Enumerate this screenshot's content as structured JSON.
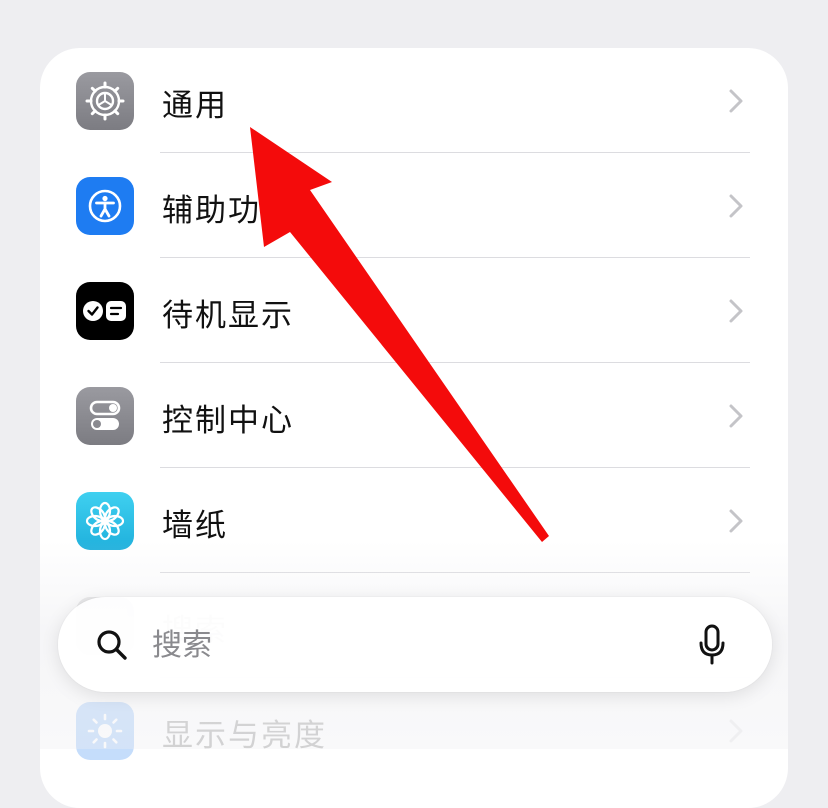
{
  "settings": {
    "items": [
      {
        "label": "通用",
        "icon": "gear-icon",
        "color": "#8e8e93"
      },
      {
        "label": "辅助功能",
        "icon": "accessibility-icon",
        "color": "#1e7cf2"
      },
      {
        "label": "待机显示",
        "icon": "standby-icon",
        "color": "#000000"
      },
      {
        "label": "控制中心",
        "icon": "toggles-icon",
        "color": "#8e8e93"
      },
      {
        "label": "墙纸",
        "icon": "flower-icon",
        "color": "#2ec4e8"
      },
      {
        "label": "显示与亮度",
        "icon": "sun-icon",
        "color": "#1e7cf2"
      }
    ],
    "hidden_item_label": "搜索"
  },
  "search": {
    "placeholder": "搜索",
    "icon": "search-icon",
    "mic_icon": "microphone-icon"
  },
  "annotation": {
    "arrow_color": "#f40b0b"
  }
}
